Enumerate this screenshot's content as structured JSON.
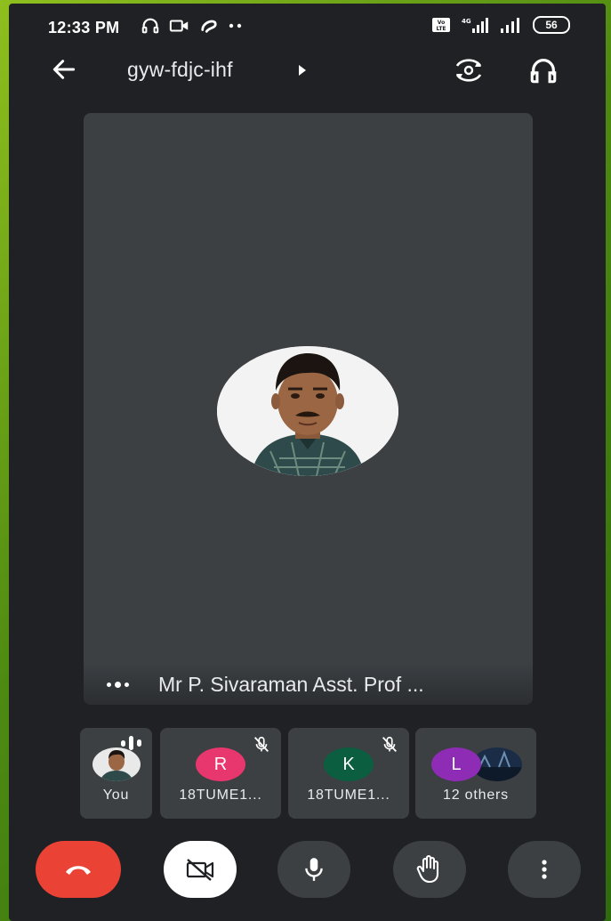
{
  "status_bar": {
    "time": "12:33 PM",
    "icons_left": [
      "headphones-icon",
      "video-icon",
      "airtel-icon",
      "more-dots-icon"
    ],
    "icons_right": [
      "volte-icon",
      "signal-4g-icon",
      "signal-icon"
    ],
    "battery": "56"
  },
  "header": {
    "meeting_code": "gyw-fdjc-ihf",
    "back_icon": "arrow-left-icon",
    "switch_camera_icon": "switch-camera-icon",
    "audio_icon": "headphones-icon"
  },
  "main_tile": {
    "speaker_name": "Mr P. Sivaraman Asst. Prof ...",
    "speaking": true
  },
  "participants": [
    {
      "label": "You",
      "type": "photo",
      "indicator": "speaking-bars-icon"
    },
    {
      "label": "18TUME1...",
      "initial": "R",
      "color": "#e8366e",
      "indicator": "mic-off-icon"
    },
    {
      "label": "18TUME1...",
      "initial": "K",
      "color": "#0b5e3f",
      "indicator": "mic-off-icon"
    },
    {
      "label": "12 others",
      "initial": "L",
      "color": "#8e2cb5",
      "type": "group"
    }
  ],
  "controls": {
    "end_call_color": "#ea4335",
    "camera": "camera-off-icon",
    "mic": "mic-icon",
    "raise_hand": "hand-icon",
    "more": "more-vert-icon"
  }
}
